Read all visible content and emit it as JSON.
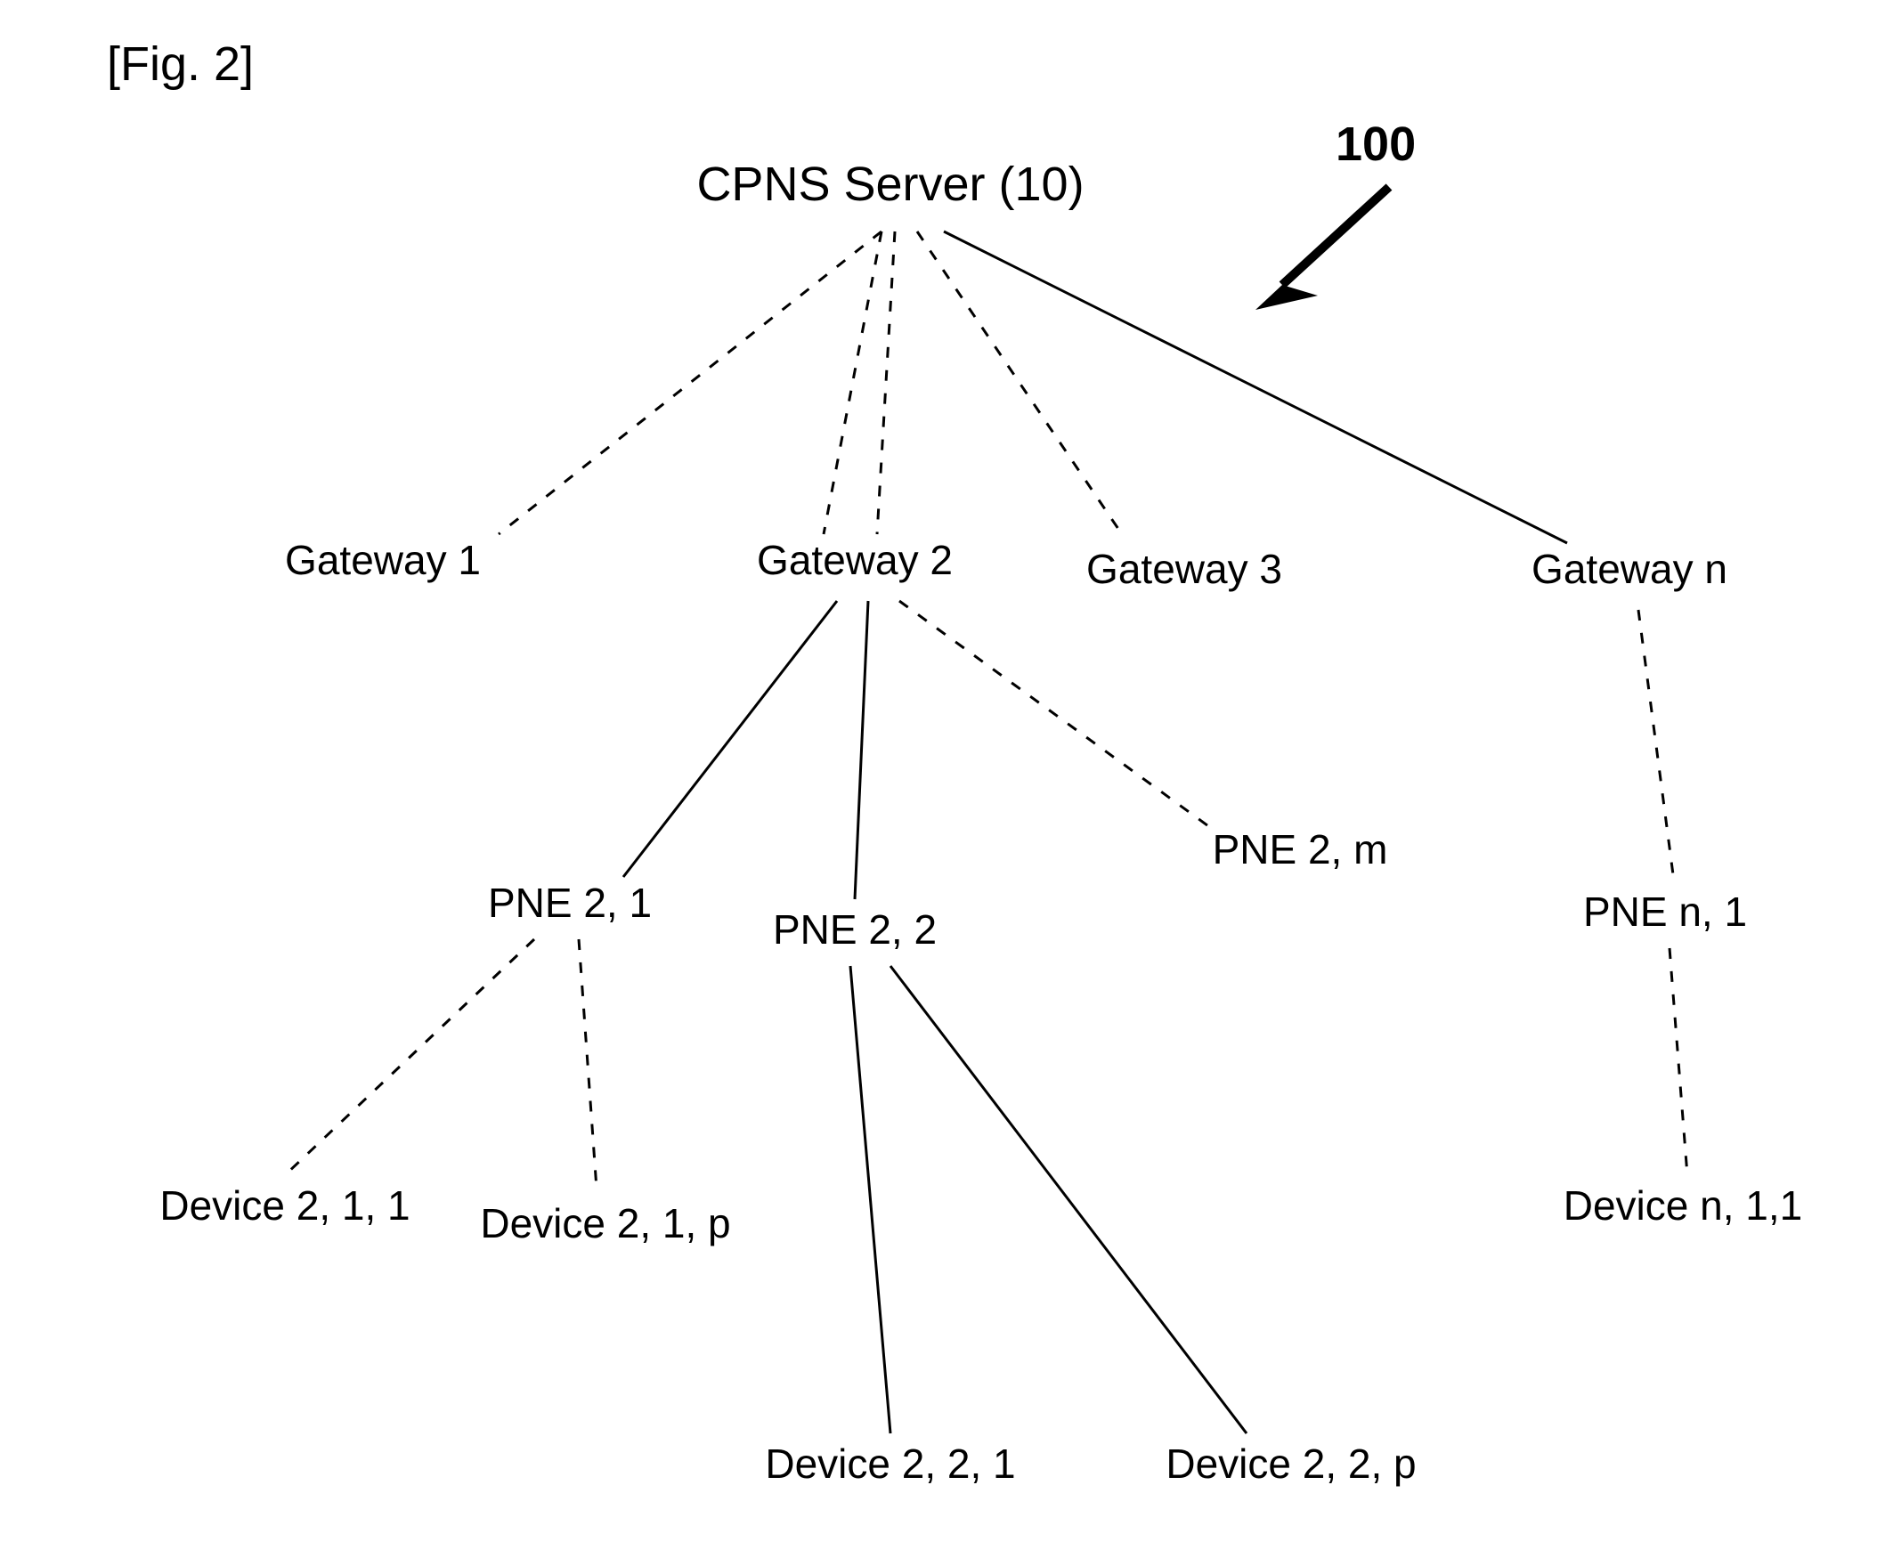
{
  "figure_label": "[Fig. 2]",
  "ref_number": "100",
  "root": "CPNS Server (10)",
  "gateways": {
    "g1": "Gateway 1",
    "g2": "Gateway 2",
    "g3": "Gateway 3",
    "gn": "Gateway n"
  },
  "pnes": {
    "p21": "PNE 2, 1",
    "p22": "PNE 2, 2",
    "p2m": "PNE 2, m",
    "pn1": "PNE n, 1"
  },
  "devices": {
    "d211": "Device 2, 1, 1",
    "d21p": "Device 2, 1, p",
    "d221": "Device 2, 2, 1",
    "d22p": "Device 2, 2, p",
    "dn11": "Device n, 1,1"
  }
}
